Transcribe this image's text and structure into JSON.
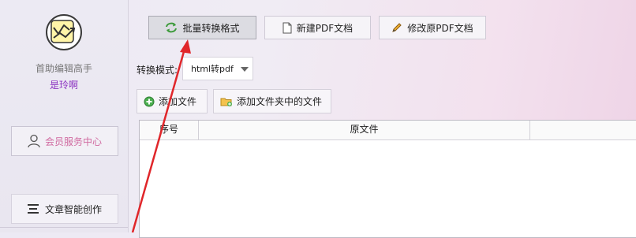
{
  "sidebar": {
    "app_name": "首助编辑高手",
    "user_name": "是玲啊",
    "member_center": "会员服务中心",
    "ai_writing": "文章智能创作"
  },
  "toolbar": {
    "tabs": [
      {
        "label": "批量转换格式",
        "icon": "convert-arrows-icon",
        "active": true
      },
      {
        "label": "新建PDF文档",
        "icon": "document-icon",
        "active": false
      },
      {
        "label": "修改原PDF文档",
        "icon": "pencil-icon",
        "active": false
      }
    ]
  },
  "mode": {
    "label": "转换模式:",
    "value": "html转pdf"
  },
  "actions": {
    "add_file": "添加文件",
    "add_folder": "添加文件夹中的文件"
  },
  "table": {
    "columns": [
      "序号",
      "原文件"
    ]
  },
  "colors": {
    "accent_purple": "#8a2fc0",
    "member_pink": "#d06aa0",
    "annotation_red": "#e0262a"
  }
}
